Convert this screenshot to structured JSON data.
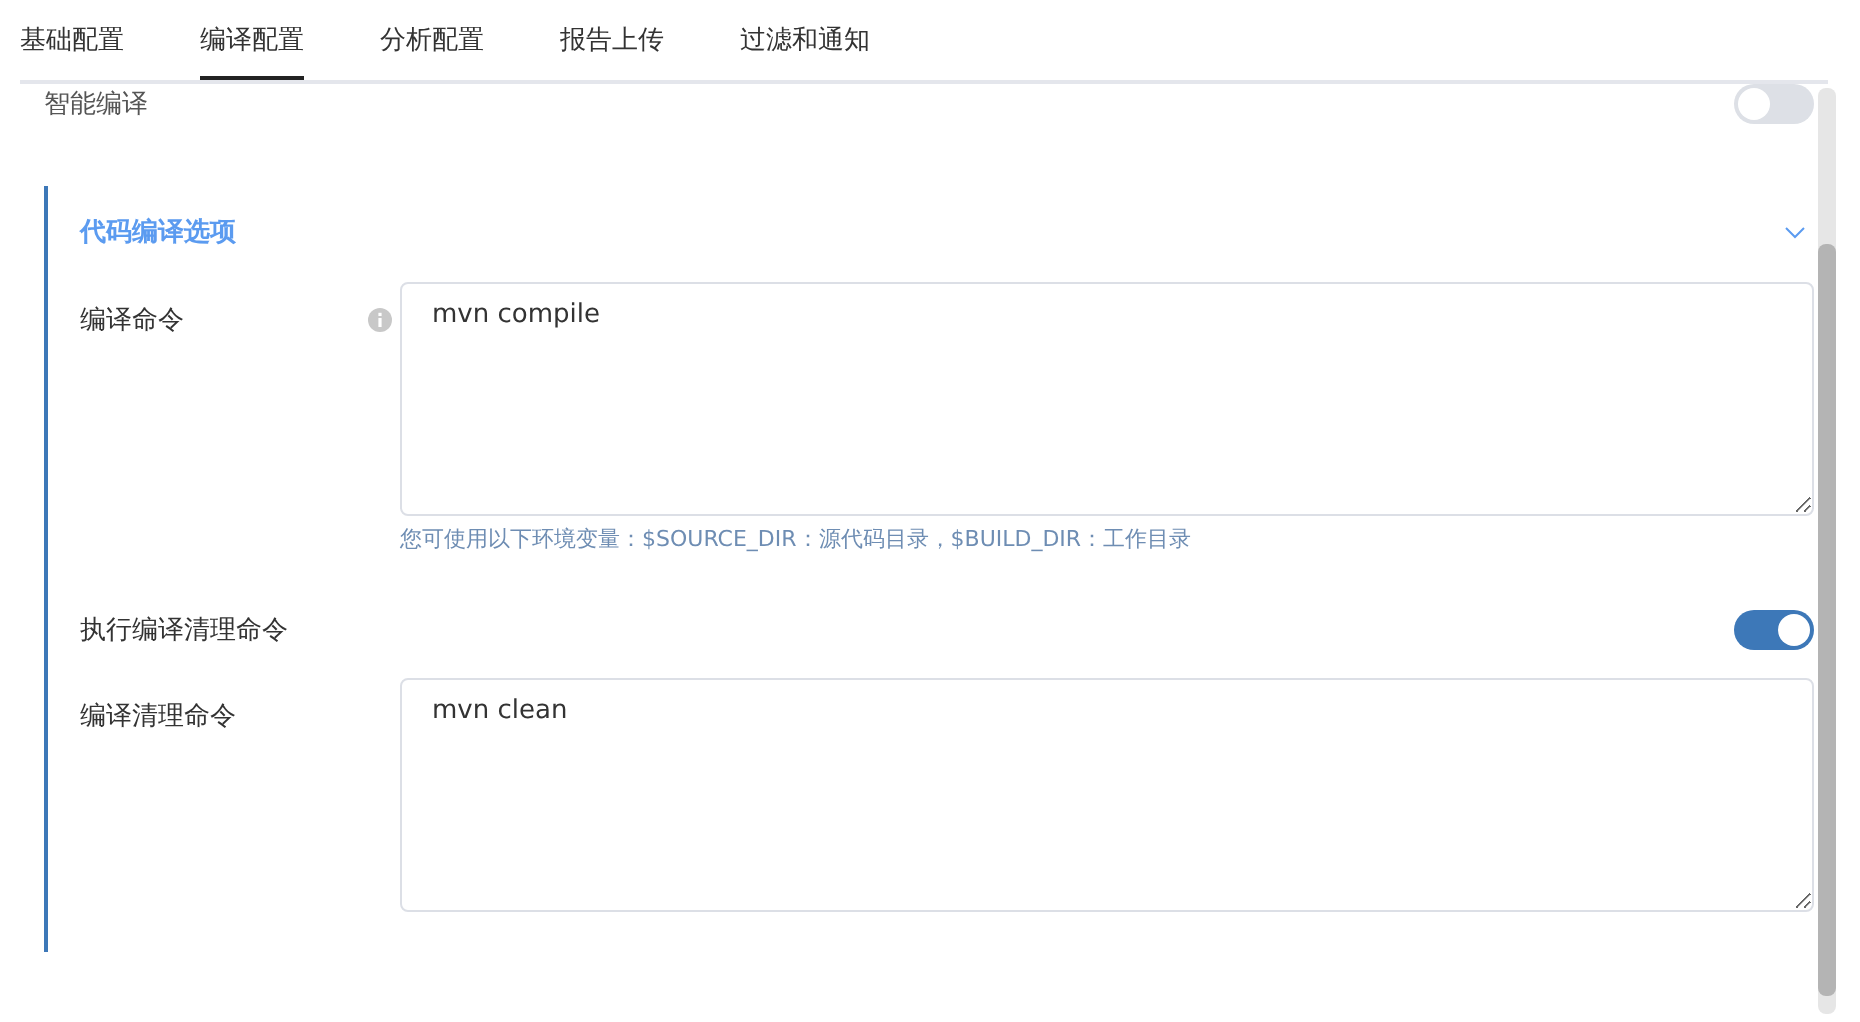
{
  "tabs": [
    {
      "label": "基础配置",
      "selected": false
    },
    {
      "label": "编译配置",
      "selected": true
    },
    {
      "label": "分析配置",
      "selected": false
    },
    {
      "label": "报告上传",
      "selected": false
    },
    {
      "label": "过滤和通知",
      "selected": false
    }
  ],
  "smart_compile": {
    "label": "智能编译",
    "on": false
  },
  "section": {
    "title": "代码编译选项",
    "expanded": true,
    "compile_command": {
      "label": "编译命令",
      "value": "mvn compile",
      "hint": "您可使用以下环境变量：$SOURCE_DIR：源代码目录，$BUILD_DIR：工作目录"
    },
    "run_clean": {
      "label": "执行编译清理命令",
      "on": true
    },
    "clean_command": {
      "label": "编译清理命令",
      "value": "mvn clean"
    }
  }
}
